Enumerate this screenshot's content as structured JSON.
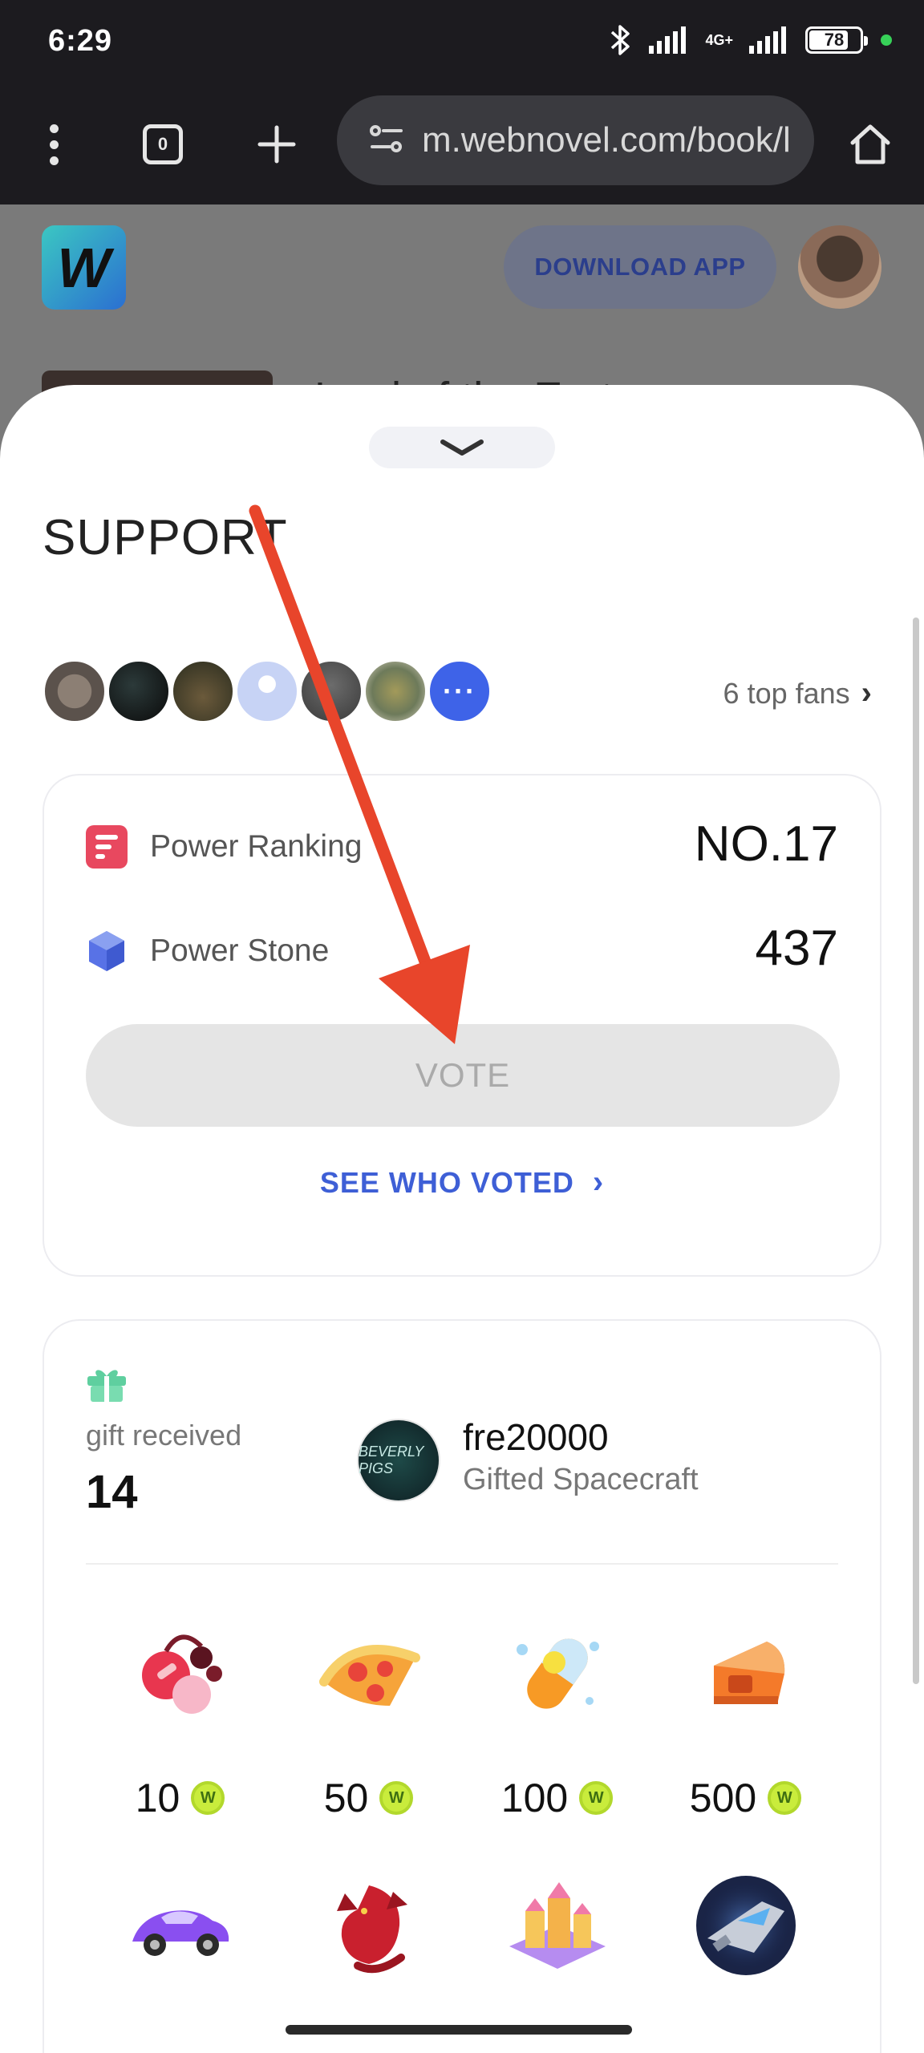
{
  "status_bar": {
    "time": "6:29",
    "network": "4G+",
    "battery_level": "78",
    "battery_fraction": 0.78
  },
  "browser": {
    "tab_count": "0",
    "url": "m.webnovel.com/book/l",
    "icons": [
      "kebab-menu-icon",
      "tabs-icon",
      "plus-icon",
      "site-settings-icon",
      "home-icon"
    ]
  },
  "page": {
    "download_label": "DOWNLOAD APP",
    "book_title": "Lord of the Eart"
  },
  "sheet": {
    "title": "SUPPORT",
    "top_fans_label": "6 top fans",
    "fans_more": "···",
    "power_ranking_label": "Power Ranking",
    "power_ranking_value": "NO.17",
    "power_stone_label": "Power Stone",
    "power_stone_value": "437",
    "vote_label": "VOTE",
    "see_who_voted": "SEE WHO VOTED",
    "gift_label": "gift received",
    "gift_count": "14",
    "gifter_name": "fre20000",
    "gifter_action": "Gifted Spacecraft",
    "gifter_avatar_text": "BEVERLY PIGS",
    "gifts": [
      {
        "price": "10",
        "icon": "cherries-gift-icon"
      },
      {
        "price": "50",
        "icon": "pizza-gift-icon"
      },
      {
        "price": "100",
        "icon": "pill-gift-icon"
      },
      {
        "price": "500",
        "icon": "whistle-gift-icon"
      },
      {
        "price": "",
        "icon": "car-gift-icon"
      },
      {
        "price": "",
        "icon": "dragon-gift-icon"
      },
      {
        "price": "",
        "icon": "castle-gift-icon"
      },
      {
        "price": "",
        "icon": "spacecraft-gift-icon"
      }
    ]
  },
  "colors": {
    "accent_blue": "#3e63e8",
    "link_blue": "#3e5fd6",
    "ranking_red": "#e8485f",
    "coin_green": "#c9ec3c",
    "annotation_arrow": "#e8452b"
  }
}
